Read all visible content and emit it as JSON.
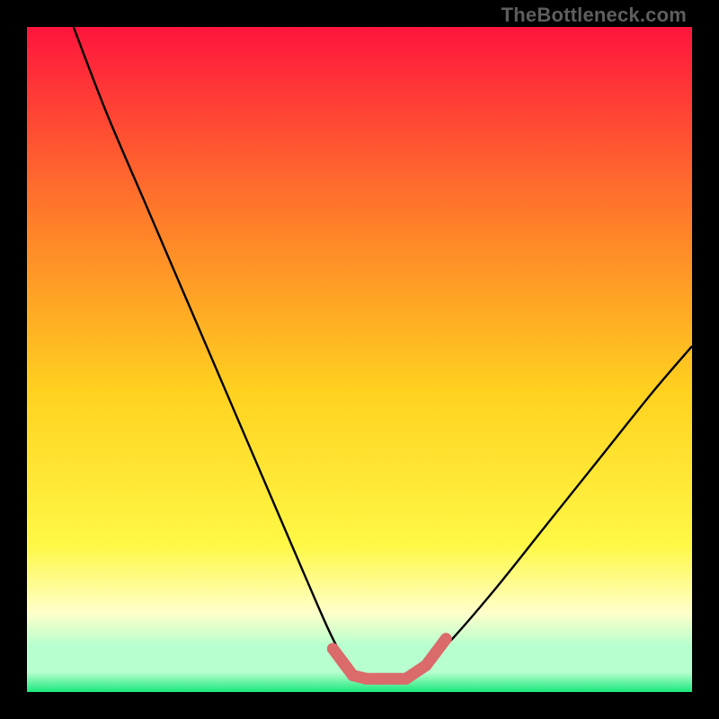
{
  "watermark": "TheBottleneck.com",
  "colors": {
    "top": "#ff153d",
    "upper_mid": "#ff7a2a",
    "mid": "#ffd21f",
    "lower_mid": "#fff846",
    "pale_yellow": "#ffffc9",
    "pale_green": "#b8ffcf",
    "green": "#18e87a",
    "marker": "#db6a6a",
    "curve": "#000000"
  },
  "chart_data": {
    "type": "line",
    "title": "",
    "xlabel": "",
    "ylabel": "",
    "xlim": [
      0,
      100
    ],
    "ylim": [
      0,
      100
    ],
    "series": [
      {
        "name": "bottleneck-curve",
        "x": [
          7,
          12,
          18,
          24,
          30,
          36,
          42,
          46,
          49,
          51,
          54,
          58,
          63,
          70,
          78,
          86,
          94,
          100
        ],
        "y": [
          100,
          87,
          73,
          59,
          45,
          31,
          17,
          8,
          3,
          2,
          2,
          3,
          7,
          15,
          25,
          35,
          45,
          52
        ]
      }
    ],
    "markers": {
      "name": "bottom-markers",
      "points": [
        {
          "x": 46,
          "y": 6.5
        },
        {
          "x": 47.5,
          "y": 4.5
        },
        {
          "x": 49,
          "y": 2.5
        },
        {
          "x": 51,
          "y": 2
        },
        {
          "x": 53,
          "y": 2
        },
        {
          "x": 55,
          "y": 2
        },
        {
          "x": 57,
          "y": 2
        },
        {
          "x": 60,
          "y": 4
        },
        {
          "x": 61.5,
          "y": 6
        },
        {
          "x": 63,
          "y": 8
        }
      ]
    }
  }
}
